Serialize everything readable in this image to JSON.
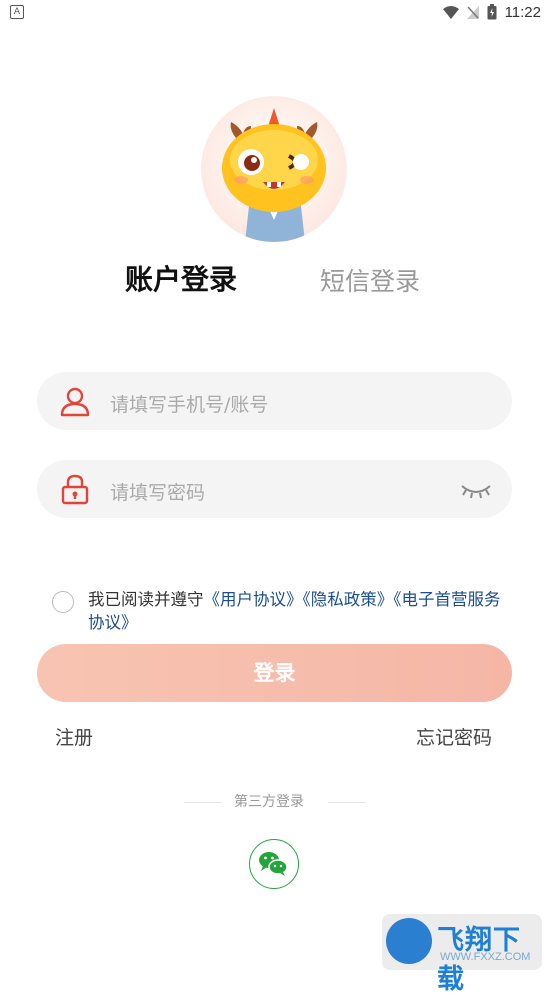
{
  "status_bar": {
    "left_badge": "A",
    "time": "11:22"
  },
  "tabs": {
    "account": "账户登录",
    "sms": "短信登录"
  },
  "form": {
    "phone_placeholder": "请填写手机号/账号",
    "password_placeholder": "请填写密码"
  },
  "agreement": {
    "prefix": "我已阅读并遵守",
    "link_user": "《用户协议》",
    "link_privacy": "《隐私政策》",
    "link_esign": "《电子首营服务协议》"
  },
  "buttons": {
    "login": "登录",
    "register": "注册",
    "forgot": "忘记密码"
  },
  "third_party": {
    "label": "第三方登录"
  },
  "watermark": {
    "brand": "飞翔下载",
    "url": "WWW.FXXZ.COM"
  },
  "colors": {
    "accent_red": "#e0453a",
    "login_button": "#f5b6a6",
    "wechat_green": "#25a33d",
    "link_blue": "#1a4d8f"
  }
}
